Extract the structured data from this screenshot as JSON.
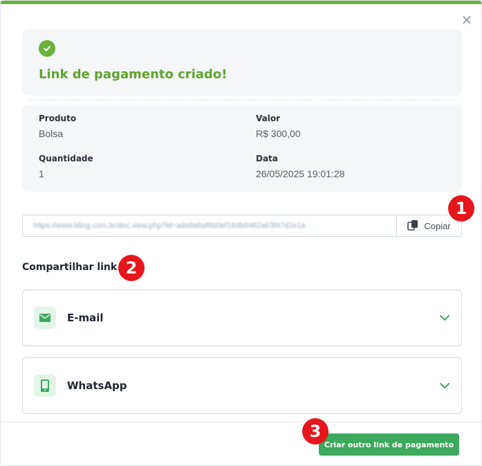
{
  "success": {
    "title": "Link de pagamento criado!"
  },
  "details": {
    "produto_label": "Produto",
    "produto_value": "Bolsa",
    "valor_label": "Valor",
    "valor_value": "R$ 300,00",
    "quantidade_label": "Quantidade",
    "quantidade_value": "1",
    "data_label": "Data",
    "data_value": "26/05/2025 19:01:28"
  },
  "link": {
    "url": "https://www.bling.com.br/doc.view.php?id=ada9a6af6b0ef16db6462a63f47d1e1a",
    "copy_label": "Copiar"
  },
  "share": {
    "title": "Compartilhar link",
    "items": [
      {
        "label": "E-mail",
        "icon": "email-icon"
      },
      {
        "label": "WhatsApp",
        "icon": "phone-icon"
      }
    ]
  },
  "footer": {
    "primary_label": "Criar outro link de pagamento"
  },
  "annotations": [
    "1",
    "2",
    "3"
  ],
  "colors": {
    "brand_green": "#6bb23c",
    "title_green": "#5ba52b",
    "button_green": "#3ca95c",
    "badge_red": "#e5161c"
  }
}
